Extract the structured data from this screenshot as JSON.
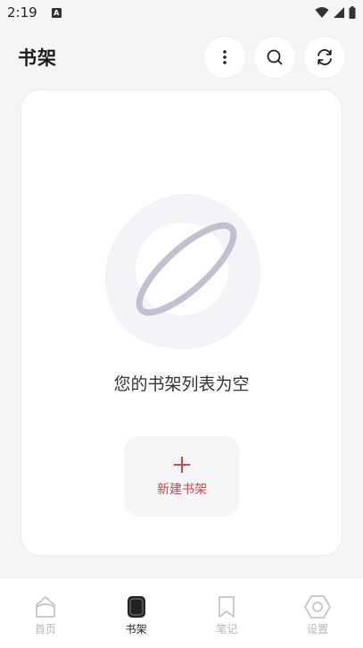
{
  "status_bar": {
    "time": "2:19",
    "notification_badge": "A"
  },
  "header": {
    "title": "书架",
    "icons": [
      "more-vertical-icon",
      "search-icon",
      "refresh-icon"
    ]
  },
  "empty_state": {
    "message": "您的书架列表为空",
    "illustration": "planet-icon"
  },
  "new_shelf": {
    "label": "新建书架",
    "icon": "plus-icon"
  },
  "bottom_nav": {
    "items": [
      {
        "label": "首页",
        "icon": "home-icon",
        "active": false
      },
      {
        "label": "书架",
        "icon": "bookshelf-icon",
        "active": true
      },
      {
        "label": "笔记",
        "icon": "bookmark-icon",
        "active": false
      },
      {
        "label": "设置",
        "icon": "settings-icon",
        "active": false
      }
    ]
  },
  "colors": {
    "accent": "#c4484f",
    "background": "#f5f5f7",
    "card": "#ffffff",
    "inactive": "#b5b5bb"
  }
}
